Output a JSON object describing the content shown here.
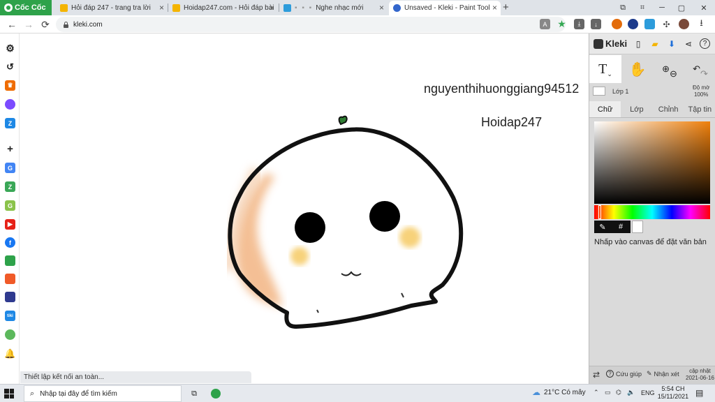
{
  "browser": {
    "brand": "Cốc Cốc",
    "tabs": [
      {
        "title": "Hỏi đáp 247 - trang tra lời",
        "favicon": "hoidap-logo-icon",
        "color": "#f4b400"
      },
      {
        "title": "Hoidap247.com - Hỏi đáp bài",
        "favicon": "hoidap-logo-icon",
        "color": "#f4b400"
      },
      {
        "title": "Nghe nhạc mới",
        "favicon": "music-icon",
        "color": "#2d9cdb"
      },
      {
        "title": "Unsaved - Kleki - Paint Tool",
        "favicon": "kleki-logo-icon",
        "color": "#3366cc",
        "active": true
      }
    ],
    "url": "kleki.com"
  },
  "status_bar": {
    "text": "Thiết lập kết nối an toàn..."
  },
  "canvas": {
    "texts": [
      "nguyenthihuonggiang94512",
      "Hoidap247"
    ]
  },
  "kleki": {
    "logo": "Kleki",
    "layer": {
      "name": "Lớp 1",
      "opacity_label": "Độ mờ",
      "opacity": "100%"
    },
    "tabs": [
      "Chữ",
      "Lớp",
      "Chỉnh",
      "Tập tin"
    ],
    "active_tab": 0,
    "color_tool": {
      "hex_symbol": "#",
      "accent": "#ef7f0a"
    },
    "hint": "Nhấp vào canvas để đặt văn bản",
    "footer": {
      "help": "Cứu giúp",
      "feedback": "Nhận xét",
      "update_label": "cập nhật",
      "update_date": "2021-06-16"
    }
  },
  "taskbar": {
    "search_placeholder": "Nhập tại đây để tìm kiếm",
    "weather": "21°C  Có mây",
    "lang": "ENG",
    "time": "5:54 CH",
    "date": "15/11/2021"
  }
}
